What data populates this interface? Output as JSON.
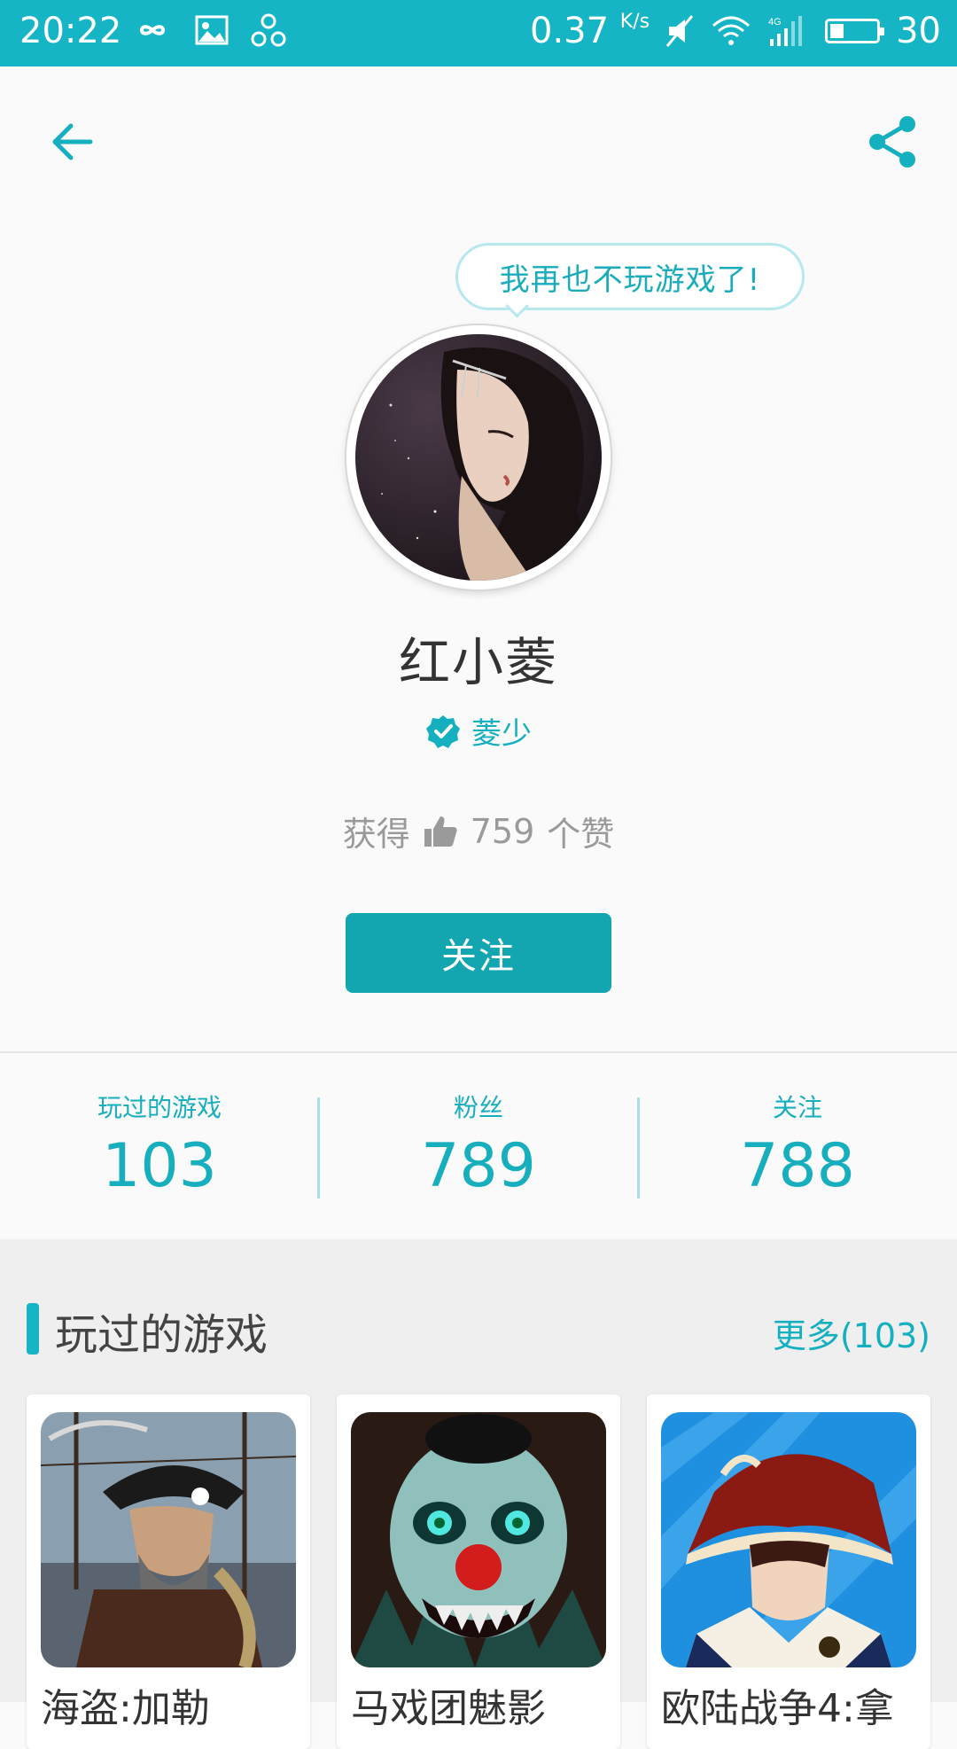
{
  "status_bar": {
    "time": "20:22",
    "speed": "0.37",
    "speed_unit": "K/s",
    "battery": "30",
    "battery_level": 0.3,
    "icons": [
      "infinity-icon",
      "image-icon",
      "link-icon",
      "mute-icon",
      "wifi-icon",
      "4g-signal-icon",
      "battery-icon"
    ]
  },
  "header": {
    "back_icon": "back-arrow-icon",
    "share_icon": "share-icon"
  },
  "profile": {
    "bubble_text": "我再也不玩游戏了!",
    "name": "红小菱",
    "verified_label": "菱少",
    "likes_prefix": "获得",
    "likes_count": "759",
    "likes_suffix": "个赞",
    "follow_button": "关注"
  },
  "stats": [
    {
      "label": "玩过的游戏",
      "value": "103"
    },
    {
      "label": "粉丝",
      "value": "789"
    },
    {
      "label": "关注",
      "value": "788"
    }
  ],
  "games_section": {
    "title": "玩过的游戏",
    "more": "更多(103)",
    "games": [
      {
        "name": "海盗:加勒"
      },
      {
        "name": "马戏团魅影"
      },
      {
        "name": "欧陆战争4:拿"
      }
    ]
  },
  "colors": {
    "accent": "#15b5c5",
    "button": "#13a6b1",
    "background": "#fafafa",
    "section_bg": "#efefef"
  }
}
